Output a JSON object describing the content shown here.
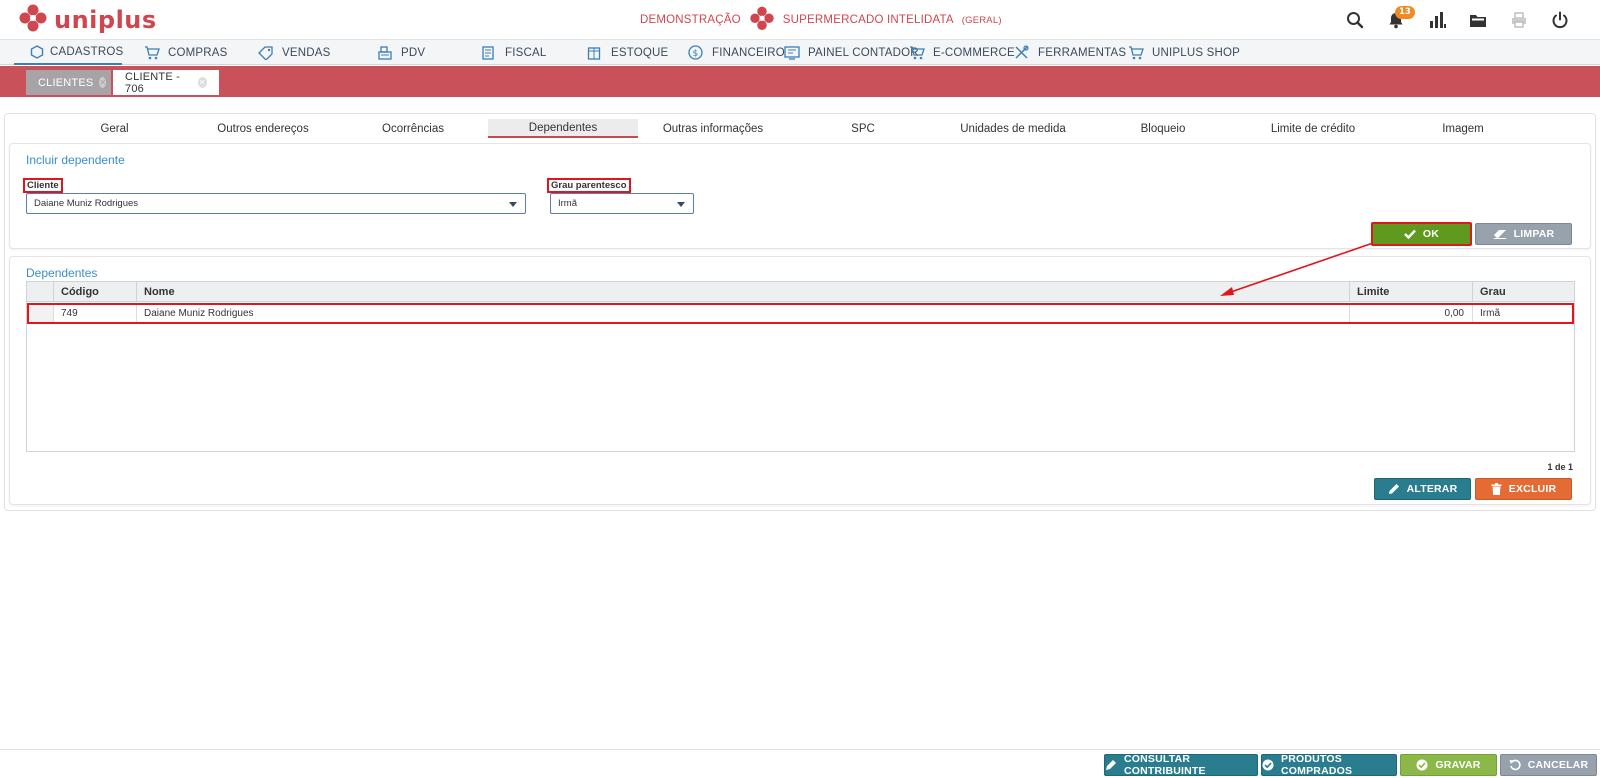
{
  "app": {
    "logo_text": "uniplus",
    "company_prefix": "DEMONSTRAÇÃO",
    "company_name": "SUPERMERCADO INTELIDATA",
    "company_scope": "(GERAL)",
    "notification_count": "13"
  },
  "menu": [
    {
      "label": "CADASTROS",
      "icon": "hexagon-icon"
    },
    {
      "label": "COMPRAS",
      "icon": "cart-icon"
    },
    {
      "label": "VENDAS",
      "icon": "tag-icon"
    },
    {
      "label": "PDV",
      "icon": "register-icon"
    },
    {
      "label": "FISCAL",
      "icon": "document-icon"
    },
    {
      "label": "ESTOQUE",
      "icon": "box-icon"
    },
    {
      "label": "FINANCEIRO",
      "icon": "dollar-icon"
    },
    {
      "label": "PAINEL CONTADOR",
      "icon": "panel-icon"
    },
    {
      "label": "E-COMMERCE",
      "icon": "cart-icon"
    },
    {
      "label": "FERRAMENTAS",
      "icon": "tools-icon"
    },
    {
      "label": "UNIPLUS SHOP",
      "icon": "cart-icon"
    }
  ],
  "doc_tabs": [
    {
      "label": "CLIENTES"
    },
    {
      "label": "CLIENTE - 706"
    }
  ],
  "subtabs": [
    "Geral",
    "Outros endereços",
    "Ocorrências",
    "Dependentes",
    "Outras informações",
    "SPC",
    "Unidades de medida",
    "Bloqueio",
    "Limite de crédito",
    "Imagem"
  ],
  "include": {
    "title": "Incluir dependente",
    "cliente_label": "Cliente",
    "cliente_value": "Daiane Muniz Rodrigues",
    "grau_label": "Grau parentesco",
    "grau_value": "Irmã",
    "ok_label": "OK",
    "limpar_label": "LIMPAR"
  },
  "dependentes": {
    "title": "Dependentes",
    "columns": [
      "Código",
      "Nome",
      "Limite",
      "Grau"
    ],
    "rows": [
      {
        "codigo": "749",
        "nome": "Daiane Muniz Rodrigues",
        "limite": "0,00",
        "grau": "Irmã"
      }
    ],
    "pager": "1 de 1",
    "alterar_label": "ALTERAR",
    "excluir_label": "EXCLUIR"
  },
  "footer": {
    "consultar_label": "CONSULTAR CONTRIBUINTE",
    "produtos_label": "PRODUTOS COMPRADOS",
    "gravar_label": "GRAVAR",
    "cancelar_label": "CANCELAR"
  },
  "colors": {
    "brand": "#d0464e",
    "accent": "#3a8fc9",
    "highlight": "#e0161e"
  }
}
